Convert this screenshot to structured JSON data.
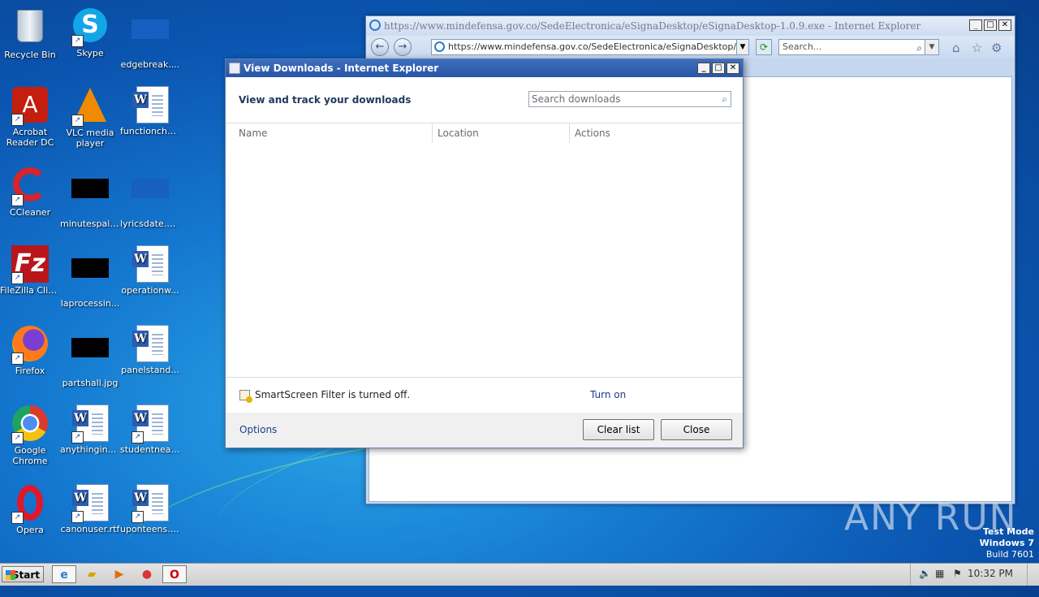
{
  "desktop_icons": [
    {
      "label": "Recycle Bin",
      "kind": "recycle-bin-icon"
    },
    {
      "label": "Skype",
      "kind": "skype-icon"
    },
    {
      "label": "edgebreak....",
      "kind": "image-file-icon"
    },
    {
      "label": "Acrobat Reader DC",
      "kind": "acrobat-icon"
    },
    {
      "label": "VLC media player",
      "kind": "vlc-icon"
    },
    {
      "label": "functioncha...",
      "kind": "word-doc-icon"
    },
    {
      "label": "CCleaner",
      "kind": "ccleaner-icon"
    },
    {
      "label": "minutespain...",
      "kind": "image-file-icon"
    },
    {
      "label": "lyricsdate.png",
      "kind": "image-file-icon"
    },
    {
      "label": "FileZilla Client",
      "kind": "filezilla-icon"
    },
    {
      "label": "laprocessin...",
      "kind": "image-file-icon"
    },
    {
      "label": "operationw...",
      "kind": "word-doc-icon"
    },
    {
      "label": "Firefox",
      "kind": "firefox-icon"
    },
    {
      "label": "partshall.jpg",
      "kind": "image-file-icon"
    },
    {
      "label": "panelstand...",
      "kind": "word-doc-icon"
    },
    {
      "label": "Google Chrome",
      "kind": "chrome-icon"
    },
    {
      "label": "anythingincl...",
      "kind": "word-doc-icon"
    },
    {
      "label": "studentnear...",
      "kind": "word-doc-icon"
    },
    {
      "label": "Opera",
      "kind": "opera-icon"
    },
    {
      "label": "canonuser.rtf",
      "kind": "word-doc-icon"
    },
    {
      "label": "uponteens.rtf",
      "kind": "word-doc-icon"
    }
  ],
  "ie_window": {
    "title": "https://www.mindefensa.gov.co/SedeElectronica/eSignaDesktop/eSignaDesktop-1.0.9.exe - Internet Explorer",
    "address": "https://www.mindefensa.gov.co/SedeElectronica/eSignaDesktop/eSignal",
    "search_placeholder": "Search..."
  },
  "downloads_dialog": {
    "title": "View Downloads - Internet Explorer",
    "heading": "View and track your downloads",
    "search_placeholder": "Search downloads",
    "columns": [
      "Name",
      "Location",
      "Actions"
    ],
    "smartscreen_text": "SmartScreen Filter is turned off.",
    "turn_on_label": "Turn on",
    "options_label": "Options",
    "clear_list_label": "Clear list",
    "close_label": "Close"
  },
  "watermark": "ANY RUN",
  "test_mode": {
    "line1": "Test Mode",
    "line2": "Windows 7",
    "line3": "Build 7601"
  },
  "taskbar": {
    "start_label": "Start",
    "clock": "10:32 PM"
  }
}
